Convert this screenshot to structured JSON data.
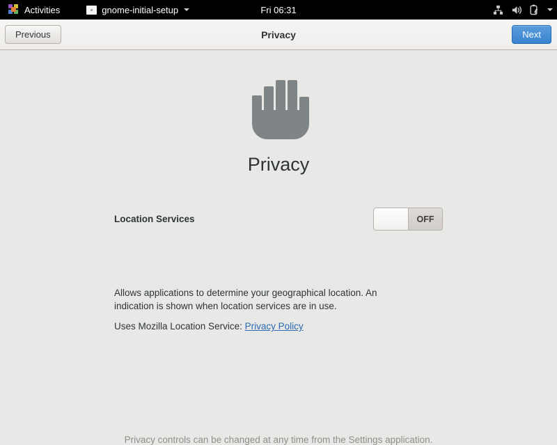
{
  "topbar": {
    "activities_label": "Activities",
    "activities_icon": "fedora-activities-icon",
    "app_name": "gnome-initial-setup",
    "app_icon": "window-icon",
    "app_menu_caret": "chevron-down-icon",
    "clock": "Fri 06:31",
    "status_icons": [
      "network-wired-icon",
      "volume-speaker-icon",
      "battery-charging-icon",
      "chevron-down-icon"
    ]
  },
  "headerbar": {
    "title": "Privacy",
    "previous_label": "Previous",
    "next_label": "Next",
    "next_accent": "#3a84d0"
  },
  "page": {
    "hero_icon": "privacy-hand-icon",
    "hero_icon_color": "#7f8487",
    "heading": "Privacy",
    "location": {
      "label": "Location Services",
      "toggle_state": "OFF",
      "toggle_on": false,
      "description": "Allows applications to determine your geographical location. An indication is shown when location services are in use.",
      "service_prefix": "Uses Mozilla Location Service:",
      "policy_link": "Privacy Policy",
      "link_color": "#2a6ab5"
    },
    "footnote": "Privacy controls can be changed at any time from the Settings application."
  }
}
